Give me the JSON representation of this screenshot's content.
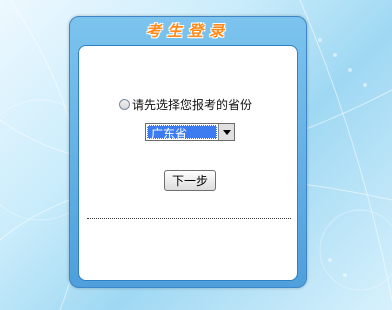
{
  "panel": {
    "title": "考生登录"
  },
  "form": {
    "prompt": "请先选择您报考的省份",
    "province_selected": "广东省",
    "next_button": "下一步"
  }
}
